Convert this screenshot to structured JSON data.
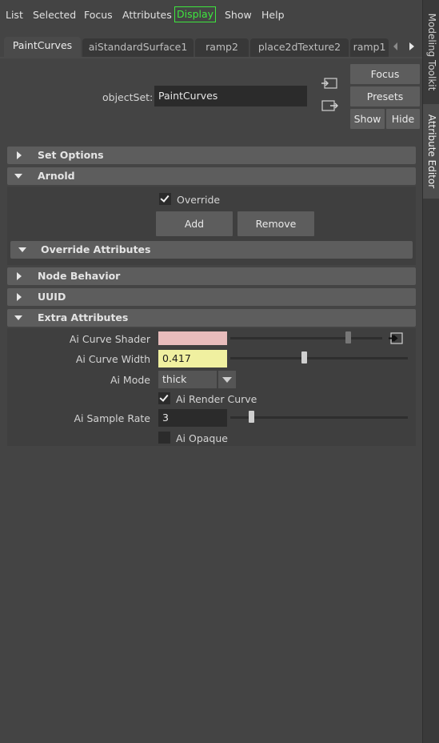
{
  "menu": {
    "items": [
      "List",
      "Selected",
      "Focus",
      "Attributes",
      "Display",
      "Show",
      "Help"
    ]
  },
  "tabs": [
    "PaintCurves",
    "aiStandardSurface1",
    "ramp2",
    "place2dTexture2",
    "ramp1"
  ],
  "side_tabs": {
    "modeling": "Modeling Toolkit",
    "attribute": "Attribute Editor"
  },
  "object_set": {
    "label": "objectSet:",
    "value": "PaintCurves"
  },
  "buttons": {
    "focus": "Focus",
    "presets": "Presets",
    "show": "Show",
    "hide": "Hide"
  },
  "sections": {
    "set_options": "Set Options",
    "arnold": "Arnold",
    "override_attributes": "Override Attributes",
    "node_behavior": "Node Behavior",
    "uuid": "UUID",
    "extra_attributes": "Extra Attributes"
  },
  "arnold": {
    "override_label": "Override",
    "override_checked": true,
    "add": "Add",
    "remove": "Remove"
  },
  "extra": {
    "curve_shader_label": "Ai Curve Shader",
    "curve_shader_color": "#e8bcbc",
    "curve_width_label": "Ai Curve Width",
    "curve_width_value": "0.417",
    "curve_width_color": "#f0f0a0",
    "mode_label": "Ai Mode",
    "mode_value": "thick",
    "render_curve_label": "Ai Render Curve",
    "render_curve_checked": true,
    "sample_rate_label": "Ai Sample Rate",
    "sample_rate_value": "3",
    "opaque_label": "Ai Opaque",
    "opaque_checked": false
  },
  "colors": {
    "highlight": "#3ee63e",
    "background": "#444444",
    "section": "#5d5d5d"
  }
}
